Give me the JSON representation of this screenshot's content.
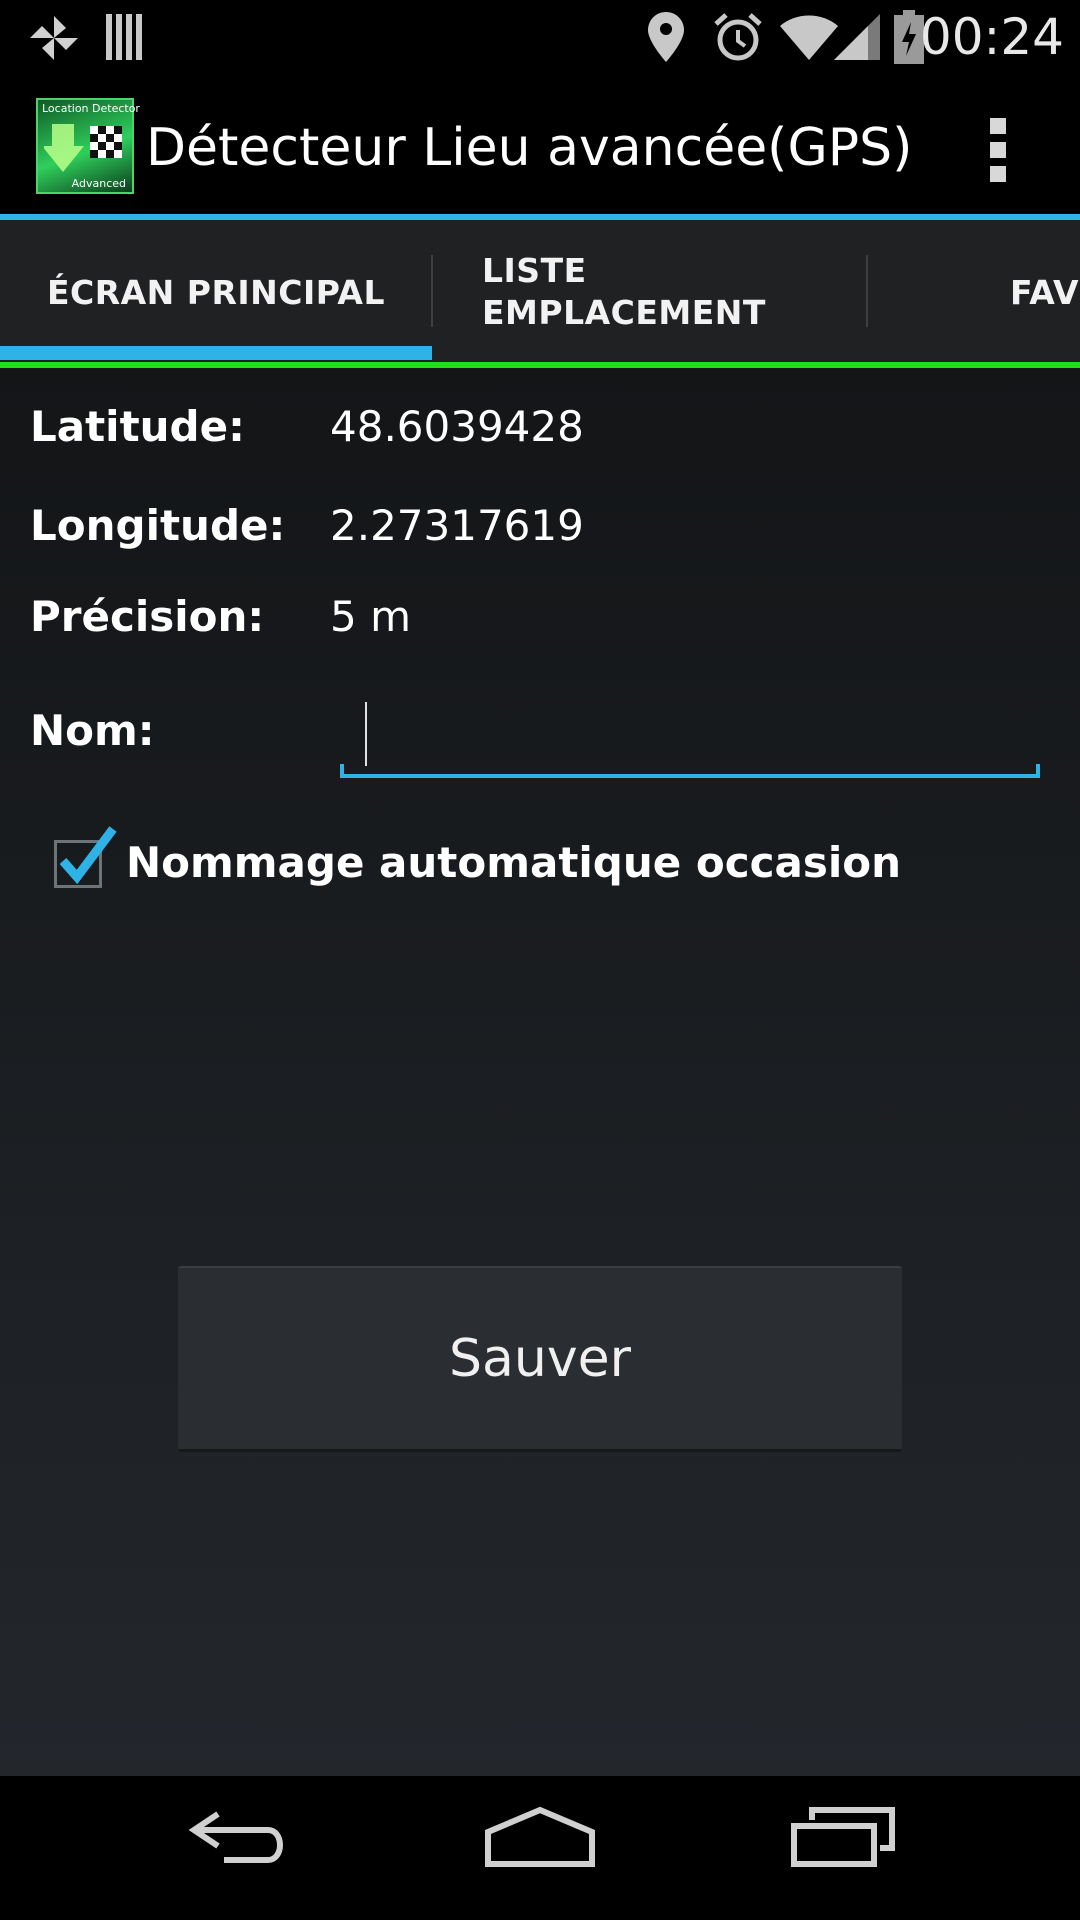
{
  "status_bar": {
    "time": "00:24",
    "icons": [
      "pinwheel-icon",
      "barcode-icon",
      "location-pin-icon",
      "alarm-icon",
      "wifi-icon",
      "signal-icon",
      "battery-charging-icon"
    ]
  },
  "action_bar": {
    "app_icon_text_top": "Location Detector",
    "app_icon_text_bottom": "Advanced",
    "title": "Détecteur Lieu avancée(GPS)",
    "overflow_icon": "overflow-menu-icon"
  },
  "tabs": {
    "items": [
      {
        "label": "ÉCRAN PRINCIPAL",
        "selected": true
      },
      {
        "label_line1": "LISTE",
        "label_line2": "EMPLACEMENT",
        "selected": false
      },
      {
        "label": "FAVO",
        "selected": false
      }
    ]
  },
  "fields": {
    "latitude_label": "Latitude:",
    "latitude_value": "48.6039428",
    "longitude_label": "Longitude:",
    "longitude_value": "2.27317619",
    "precision_label": "Précision:",
    "precision_value": "5 m",
    "name_label": "Nom:",
    "name_value": ""
  },
  "auto_naming": {
    "label": "Nommage automatique occasion",
    "checked": true
  },
  "save_button": {
    "label": "Sauver"
  },
  "colors": {
    "accent_blue": "#2fb2e6",
    "accent_green": "#1fe01f",
    "tab_bg": "#1f2123"
  },
  "nav_bar": {
    "icons": [
      "back-icon",
      "home-icon",
      "recent-apps-icon"
    ]
  }
}
